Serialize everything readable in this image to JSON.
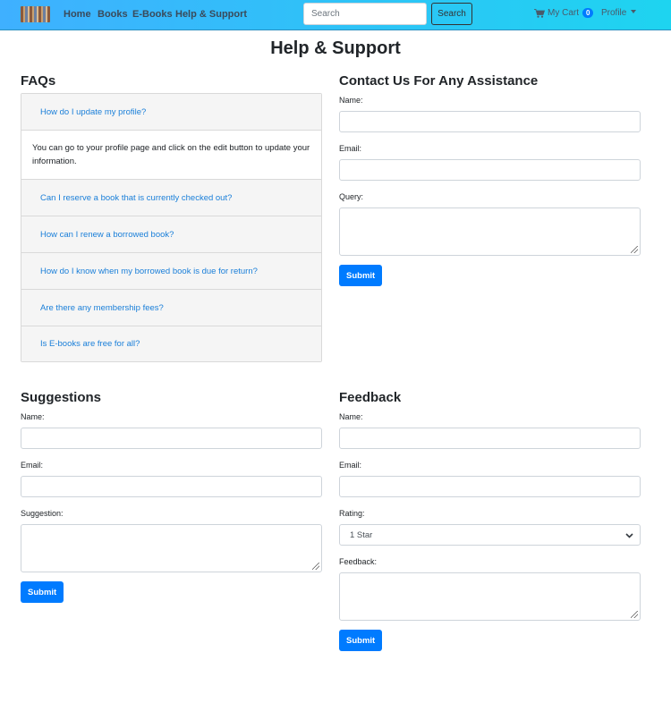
{
  "nav": {
    "links": [
      "Home",
      "Books",
      "E-Books",
      "Help & Support"
    ],
    "search_placeholder": "Search",
    "search_button": "Search",
    "cart_label": "My Cart",
    "cart_count": "0",
    "profile_label": "Profile"
  },
  "page_title": "Help & Support",
  "faq": {
    "title": "FAQs",
    "items": [
      {
        "q": "How do I update my profile?",
        "a": "You can go to your profile page and click on the edit button to update your information."
      },
      {
        "q": "Can I reserve a book that is currently checked out?"
      },
      {
        "q": "How can I renew a borrowed book?"
      },
      {
        "q": "How do I know when my borrowed book is due for return?"
      },
      {
        "q": "Are there any membership fees?"
      },
      {
        "q": "Is E-books are free for all?"
      }
    ]
  },
  "contact": {
    "title": "Contact Us For Any Assistance",
    "name_label": "Name:",
    "email_label": "Email:",
    "query_label": "Query:",
    "submit": "Submit"
  },
  "suggestions": {
    "title": "Suggestions",
    "name_label": "Name:",
    "email_label": "Email:",
    "suggestion_label": "Suggestion:",
    "submit": "Submit"
  },
  "feedback": {
    "title": "Feedback",
    "name_label": "Name:",
    "email_label": "Email:",
    "rating_label": "Rating:",
    "rating_value": "1 Star",
    "feedback_label": "Feedback:",
    "submit": "Submit"
  },
  "colors": {
    "primary": "#007bff",
    "link": "#1a7fd9",
    "navbar_start": "#3fb0ff",
    "navbar_end": "#1ed4f0"
  }
}
